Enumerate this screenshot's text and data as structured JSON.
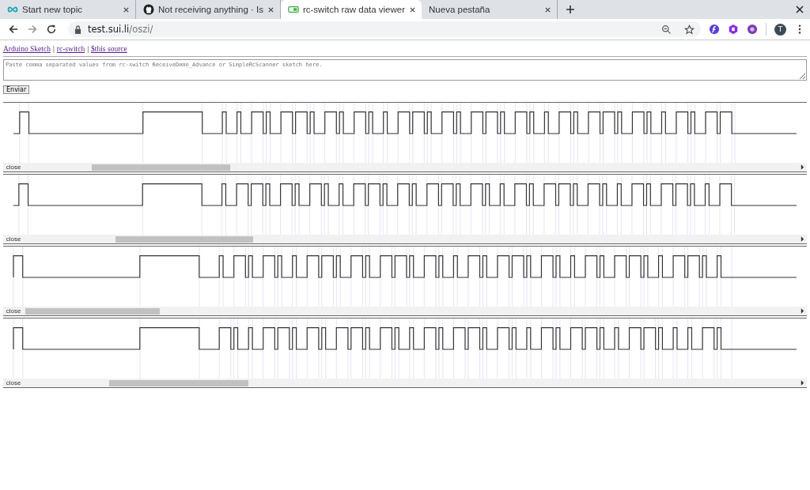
{
  "browser": {
    "tabs": [
      {
        "title": "Start new topic",
        "kind": "infinity",
        "selected": false
      },
      {
        "title": "Not receiving anything · Is",
        "kind": "github",
        "selected": false
      },
      {
        "title": "rc-switch raw data viewer",
        "kind": "toggle",
        "selected": true
      },
      {
        "title": "Nueva pestaña",
        "kind": "none",
        "selected": false
      }
    ],
    "address": {
      "host": "test.sui.li",
      "path": "/oszi/"
    },
    "profile_initial": "T"
  },
  "page": {
    "links": [
      "Arduino Sketch",
      "rc-switch",
      "$this source"
    ],
    "separator": "|",
    "input": {
      "placeholder": "Paste comma separated values from rc-switch ReceiveDemo_Advance or SimpleRcScanner sketch here."
    },
    "submit": "Enviar",
    "panels": [
      {
        "close_label": "close"
      },
      {
        "close_label": "close"
      },
      {
        "close_label": "close"
      },
      {
        "close_label": "close"
      }
    ]
  }
}
